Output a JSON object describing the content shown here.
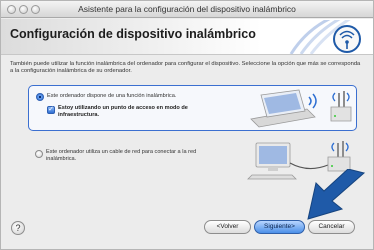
{
  "window": {
    "title": "Asistente para la configuración del dispositivo inalámbrico"
  },
  "header": {
    "title": "Configuración de dispositivo inalámbrico"
  },
  "intro_text": "También puede utilizar la función inalámbrica del ordenador para configurar el dispositivo. Seleccione la opción que más se corresponda a la configuración inalámbrica de su ordenador.",
  "options": [
    {
      "label": "Este ordenador dispone de una función inalámbrica.",
      "selected": true,
      "sub_checkbox": {
        "label_line1": "Estoy utilizando un punto de acceso en modo de",
        "label_line2": "infraestructura.",
        "checked": true
      }
    },
    {
      "label_line1": "Este ordenador utiliza un cable de red para conectar a la red",
      "label_line2": "inalámbrica.",
      "selected": false
    }
  ],
  "buttons": {
    "help": "?",
    "back": "<Volver",
    "next": "Siguiente>",
    "cancel": "Cancelar"
  },
  "colors": {
    "accent": "#3b6fd0",
    "arrow": "#1f5aa8"
  }
}
